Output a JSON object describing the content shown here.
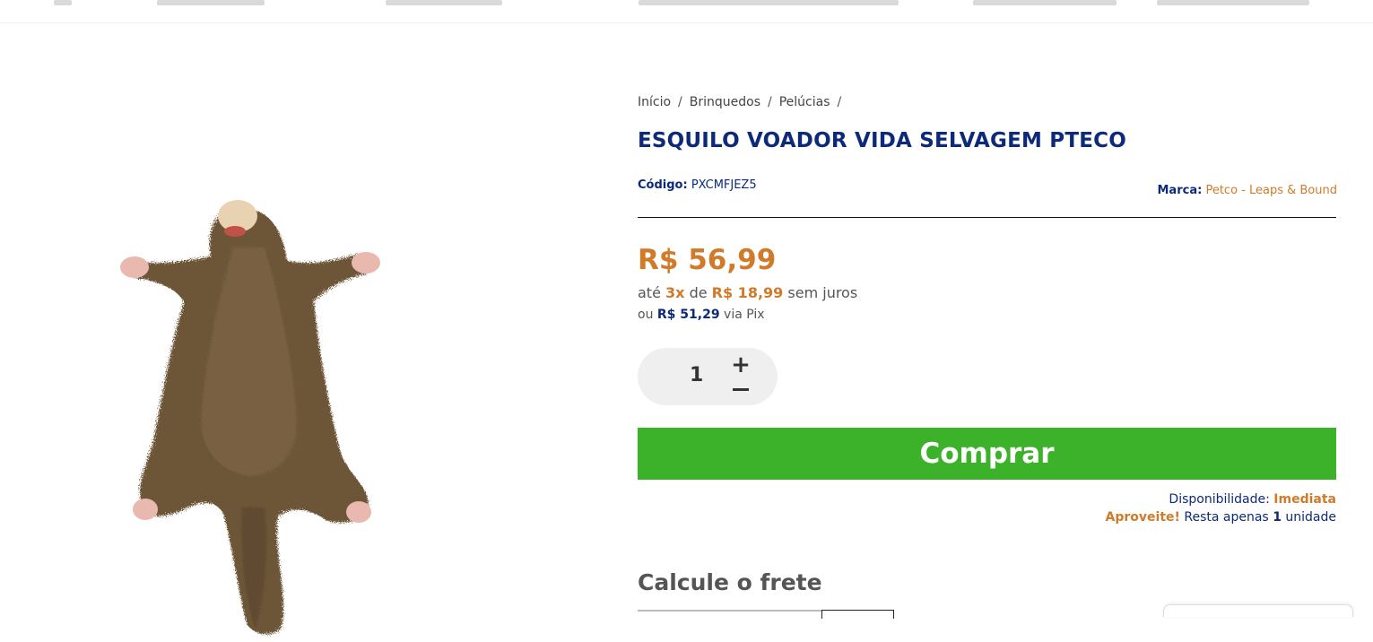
{
  "breadcrumb": {
    "items": [
      "Início",
      "Brinquedos",
      "Pelúcias"
    ],
    "separator": "/"
  },
  "product": {
    "title": "ESQUILO VOADOR VIDA SELVAGEM PTECO",
    "code_label": "Código:",
    "code_value": "PXCMFJEZ5",
    "brand_label": "Marca:",
    "brand_value": "Petco - Leaps & Bound",
    "price": "R$ 56,99",
    "installments": {
      "prefix": "até",
      "count": "3x",
      "middle": "de",
      "value": "R$ 18,99",
      "suffix": "sem juros"
    },
    "pix": {
      "prefix": "ou",
      "value": "R$ 51,29",
      "suffix": "via Pix"
    },
    "image_icon": "plush-toy-image"
  },
  "quantity": {
    "value": "1",
    "plus": "+",
    "minus": "−"
  },
  "buy_button": {
    "label": "Comprar"
  },
  "availability": {
    "label": "Disponibilidade:",
    "value": "Imediata"
  },
  "stock": {
    "lead": "Aproveite!",
    "text": "Resta apenas",
    "count": "1",
    "unit": "unidade"
  },
  "freight": {
    "title": "Calcule o frete"
  },
  "colors": {
    "navy": "#0d2a7a",
    "orange": "#d07a2a",
    "buy_green": "#3cb22a",
    "qty_bg": "#efefef"
  }
}
